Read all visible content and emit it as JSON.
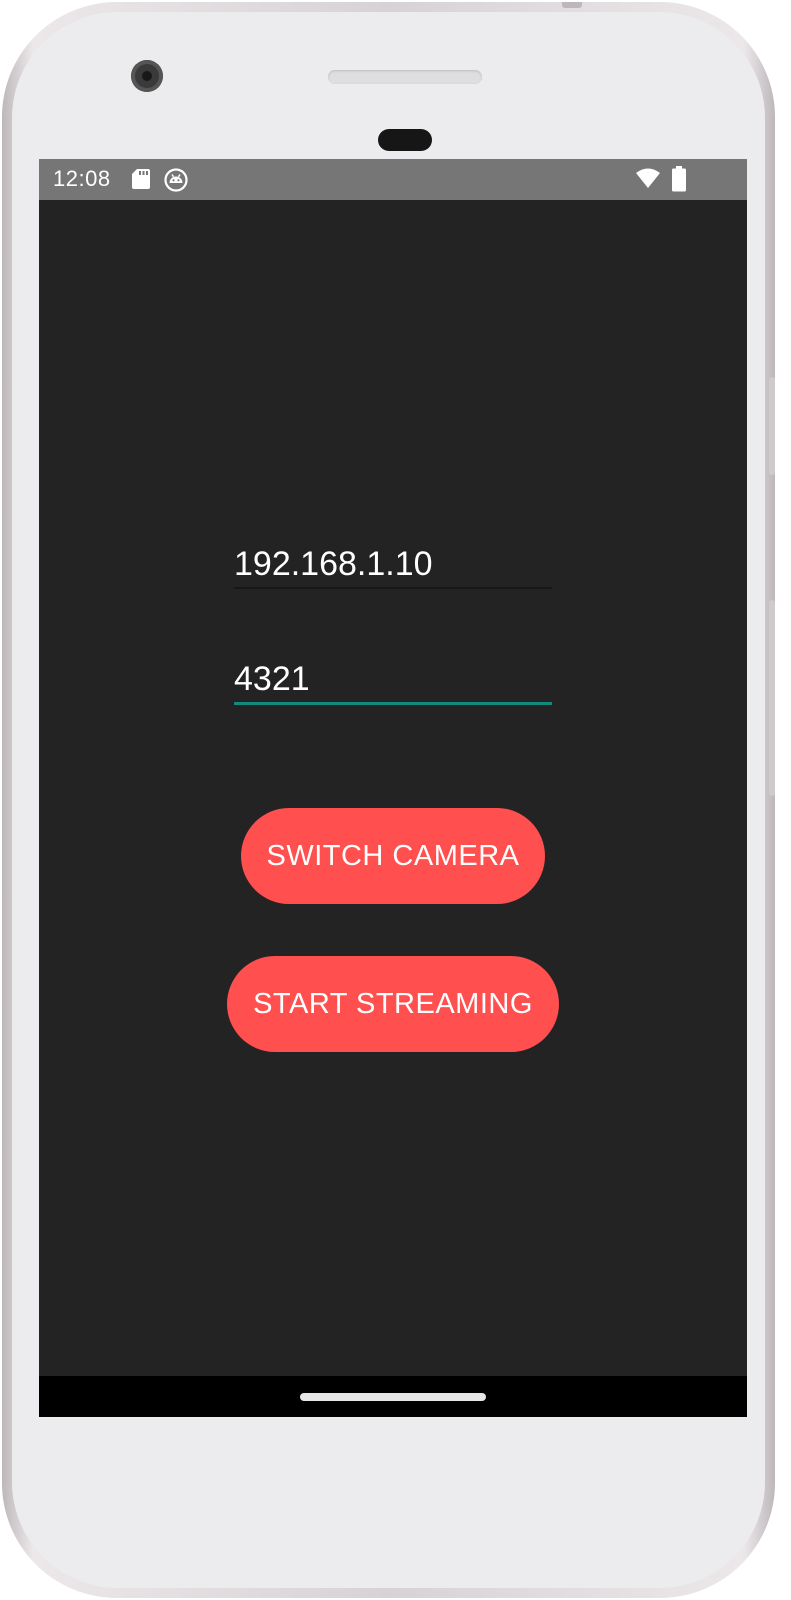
{
  "status_bar": {
    "time": "12:08",
    "left_icons": [
      "sd-card-icon",
      "android-debug-icon"
    ],
    "right_icons": [
      "wifi-icon",
      "battery-icon"
    ],
    "background": "#767676"
  },
  "form": {
    "ip_address": {
      "value": "192.168.1.10",
      "placeholder": ""
    },
    "port": {
      "value": "4321",
      "placeholder": "",
      "focused": true,
      "underline_color": "#138a7e"
    }
  },
  "buttons": {
    "switch_camera": "SWITCH CAMERA",
    "start_streaming": "START STREAMING"
  },
  "colors": {
    "app_background": "#232323",
    "button_accent": "#ff4f4f",
    "focus_accent": "#138a7e"
  }
}
